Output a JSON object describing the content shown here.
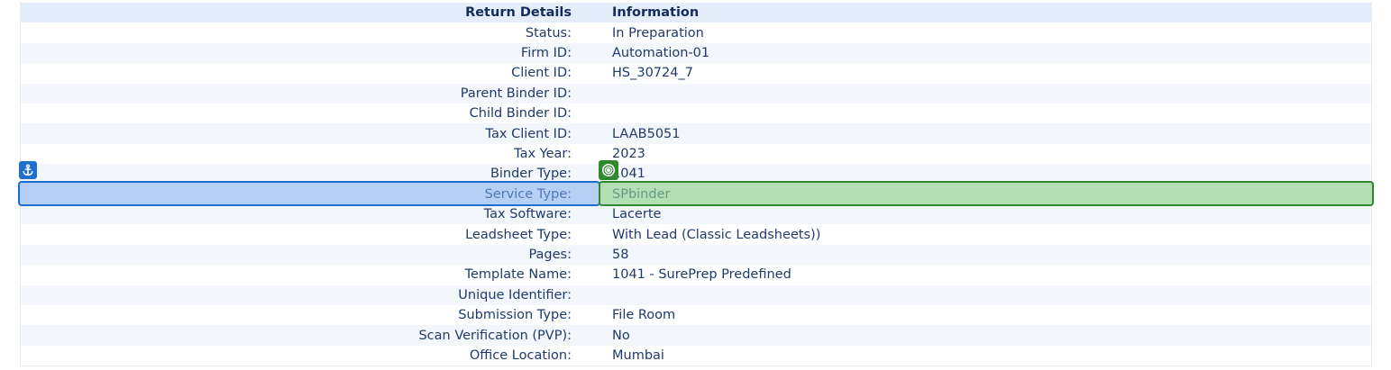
{
  "table": {
    "header_label": "Return Details",
    "header_value": "Information",
    "rows": [
      {
        "label": "Status:",
        "value": "In Preparation"
      },
      {
        "label": "Firm ID:",
        "value": "Automation-01"
      },
      {
        "label": "Client ID:",
        "value": "HS_30724_7"
      },
      {
        "label": "Parent Binder ID:",
        "value": ""
      },
      {
        "label": "Child Binder ID:",
        "value": ""
      },
      {
        "label": "Tax Client ID:",
        "value": "LAAB5051"
      },
      {
        "label": "Tax Year:",
        "value": "2023"
      },
      {
        "label": "Binder Type:",
        "value": "1041"
      },
      {
        "label": "Service Type:",
        "value": "SPbinder"
      },
      {
        "label": "Tax Software:",
        "value": "Lacerte"
      },
      {
        "label": "Leadsheet Type:",
        "value": "With Lead (Classic Leadsheets))"
      },
      {
        "label": "Pages:",
        "value": "58"
      },
      {
        "label": "Template Name:",
        "value": "1041 - SurePrep Predefined"
      },
      {
        "label": "Unique Identifier:",
        "value": ""
      },
      {
        "label": "Submission Type:",
        "value": "File Room"
      },
      {
        "label": "Scan Verification (PVP):",
        "value": "No"
      },
      {
        "label": "Office Location:",
        "value": "Mumbai"
      }
    ]
  },
  "overlay": {
    "anchor_icon": "anchor-icon",
    "target_icon": "target-icon",
    "anchor_color": "#1f6fd1",
    "target_color": "#2f8a2f"
  }
}
